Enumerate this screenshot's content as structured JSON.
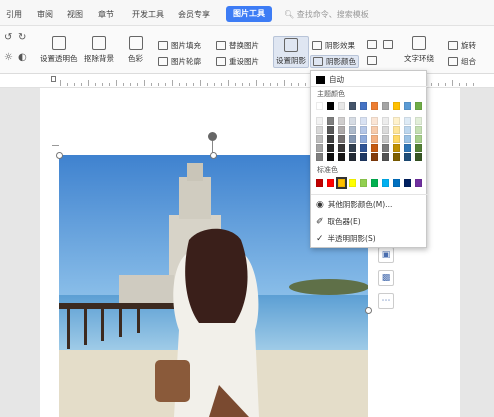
{
  "tabs": [
    {
      "label": "引用"
    },
    {
      "label": "审阅"
    },
    {
      "label": "视图"
    },
    {
      "label": "章节"
    },
    {
      "label": "开发工具"
    },
    {
      "label": "会员专享"
    },
    {
      "label": "图片工具"
    }
  ],
  "search": {
    "placeholder": "查找命令、搜索模板"
  },
  "ribbon": {
    "set_transparent": "设置透明色",
    "remove_background": "抠除背景",
    "color": "色彩",
    "picture_fill": "图片填充",
    "picture_outline": "图片轮廓",
    "replace_picture": "替换图片",
    "reset_picture": "重设图片",
    "set_shadow": "设置阴影",
    "shadow_effect": "阴影效果",
    "shadow_color": "阴影颜色",
    "text_wrap": "文字环绕",
    "rotate": "旋转",
    "combine": "组合"
  },
  "shadow_menu": {
    "auto": "自动",
    "theme_colors_label": "主题颜色",
    "standard_colors_label": "标准色",
    "more_colors": "其他阴影颜色(M)...",
    "eyedropper": "取色器(E)",
    "semi_transparent": "半透明阴影(S)",
    "semi_transparent_checked": true,
    "theme_top_row": [
      "#ffffff",
      "#000000",
      "#e8e8e8",
      "#44546a",
      "#4472c4",
      "#ed7d31",
      "#a5a5a5",
      "#ffc000",
      "#5b9bd5",
      "#70ad47"
    ],
    "theme_grid": [
      [
        "#f2f2f2",
        "#7f7f7f",
        "#d0cece",
        "#d6dce4",
        "#d9e2f3",
        "#fbe5d5",
        "#ededed",
        "#fff2cc",
        "#deebf6",
        "#e2efd9"
      ],
      [
        "#d8d8d8",
        "#595959",
        "#aeaaaa",
        "#acb9ca",
        "#b4c6e7",
        "#f7cbac",
        "#dbdbdb",
        "#fee599",
        "#bdd7ee",
        "#c5e0b3"
      ],
      [
        "#bfbfbf",
        "#3f3f3f",
        "#757070",
        "#8496b0",
        "#8eaadb",
        "#f4b183",
        "#c9c9c9",
        "#ffd965",
        "#9cc3e5",
        "#a8d08d"
      ],
      [
        "#a5a5a5",
        "#262626",
        "#3a3838",
        "#323f4f",
        "#2f5496",
        "#c55a11",
        "#7b7b7b",
        "#bf9000",
        "#2e75b5",
        "#538135"
      ],
      [
        "#7f7f7f",
        "#0d0d0d",
        "#171616",
        "#222a35",
        "#1e3864",
        "#843c0b",
        "#525252",
        "#7f6000",
        "#1e4e79",
        "#375623"
      ]
    ],
    "standard": [
      "#c00000",
      "#ff0000",
      "#ffc000",
      "#ffff00",
      "#92d050",
      "#00b050",
      "#00b0f0",
      "#0070c0",
      "#002060",
      "#7030a0"
    ],
    "selected_standard_index": 2
  }
}
